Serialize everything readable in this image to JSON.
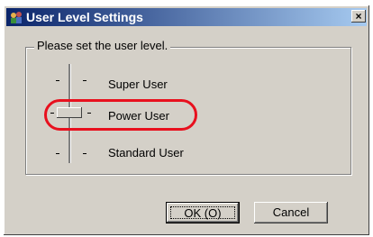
{
  "window": {
    "title": "User Level Settings",
    "close_label": "×"
  },
  "group": {
    "legend": "Please set the user level."
  },
  "slider": {
    "levels": [
      "Super User",
      "Power User",
      "Standard User"
    ],
    "selected": "Power User"
  },
  "buttons": {
    "ok_label": "OK (O)",
    "cancel_label": "Cancel"
  },
  "colors": {
    "highlight": "#e8101e",
    "title_bar": "#0a246a"
  }
}
